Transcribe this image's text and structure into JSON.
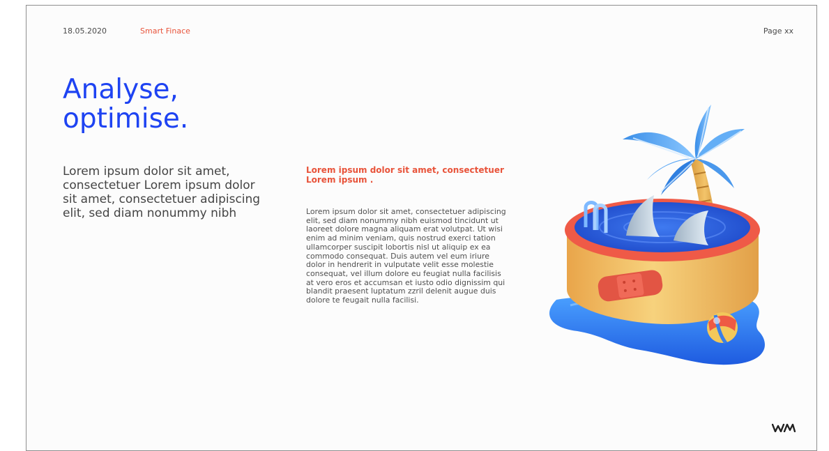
{
  "header": {
    "date": "18.05.2020",
    "brand": "Smart Finace",
    "page": "Page xx"
  },
  "title": {
    "line1": "Analyse,",
    "line2": "optimise."
  },
  "intro": "Lorem ipsum dolor sit amet, consectetuer Lorem ipsum dolor sit amet, consectetuer adipiscing elit, sed diam nonummy nibh",
  "subheading": "Lorem ipsum dolor sit amet, consectetuer Lorem ipsum .",
  "body": "Lorem ipsum dolor sit amet, consectetuer adipiscing elit, sed diam nonummy nibh euismod tincidunt ut laoreet dolore magna aliquam erat volutpat. Ut wisi enim ad minim veniam, quis nostrud exerci tation ullamcorper suscipit lobortis nisl ut aliquip ex ea commodo consequat. Duis autem vel eum iriure dolor in hendrerit in vulputate velit esse molestie consequat, vel illum dolore eu feugiat nulla facilisis at vero eros et accumsan et iusto odio dignissim qui blandit praesent luptatum zzril delenit augue duis dolore te feugait nulla facilisi.",
  "illustration": {
    "icon": "pool-palm-shark-illustration"
  },
  "footer": {
    "logo": "wm-logo-icon"
  },
  "colors": {
    "accent_blue": "#1e43f2",
    "accent_red": "#e8533a",
    "text": "#444444"
  }
}
